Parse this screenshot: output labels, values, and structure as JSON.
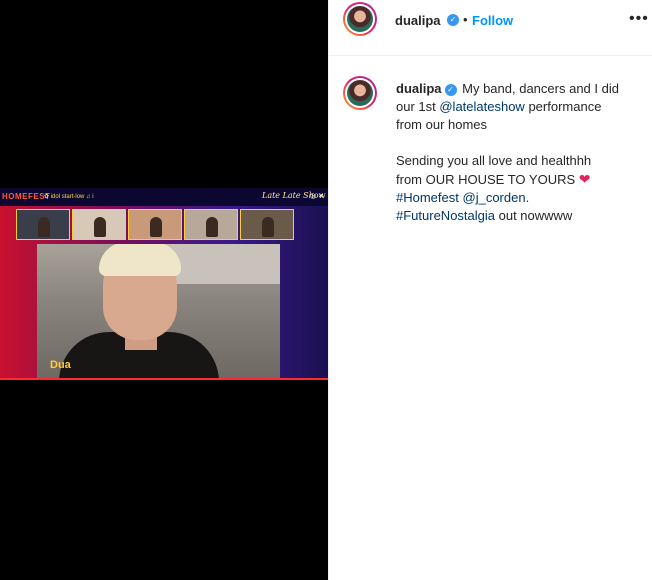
{
  "post": {
    "username": "dualipa",
    "verified_mark": "✓",
    "separator": "•",
    "follow_label": "Follow",
    "more_label": "•••"
  },
  "video": {
    "brand": "HOMEFEST",
    "top_text": "✿ idol start-low ♫ i",
    "show_logo": "Late Late Show",
    "controls": "◎ ✕",
    "name_tag": "Dua",
    "tile_colors": [
      "#3a3e4a",
      "#d8c8b8",
      "#c89a7a",
      "#b8a89a",
      "#6a5a4a"
    ]
  },
  "caption": {
    "line1_text": "My band, dancers and I did",
    "line2_a": "our 1st ",
    "mention_show": "@latelateshow",
    "line2_b": " performance",
    "line3": "from our homes",
    "line4": "Sending you all love and healthhh",
    "line5": "from OUR HOUSE TO YOURS",
    "heart": "❤",
    "hashtag_homefest": "#Homefest",
    "mention_corden": "@j_corden",
    "period": ".",
    "hashtag_nostalgia": "#FutureNostalgia",
    "line7_b": " out nowwww"
  },
  "icons": {
    "heart": "heart-icon",
    "verified": "verified-badge-icon",
    "more": "more-options-icon"
  }
}
